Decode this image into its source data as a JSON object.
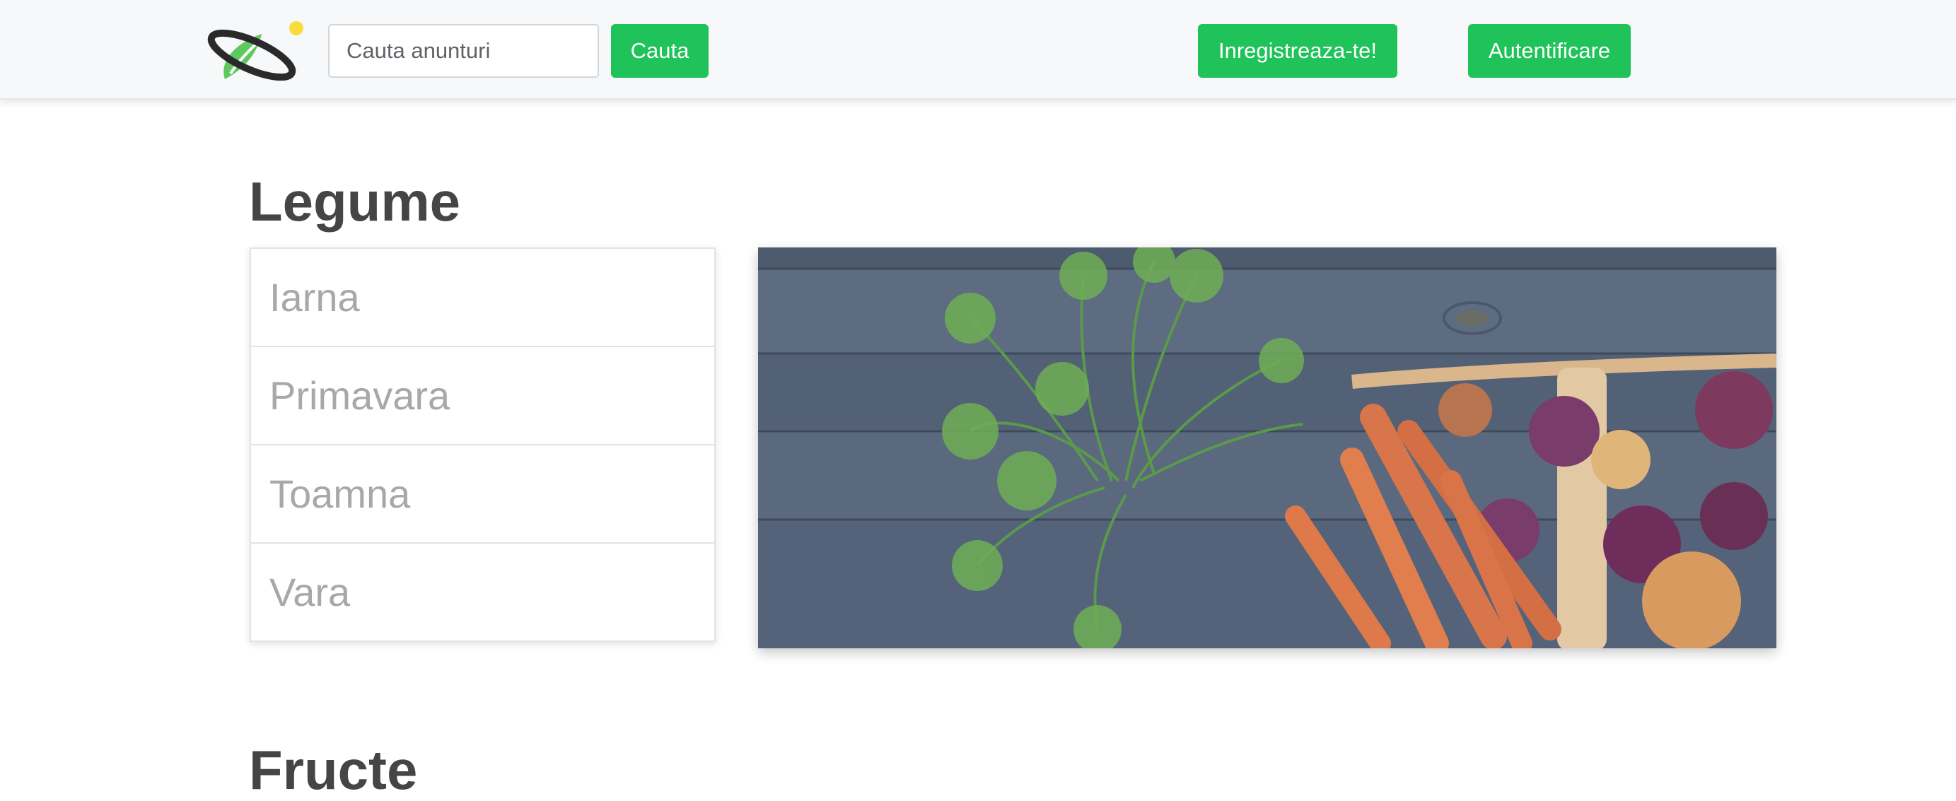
{
  "header": {
    "logo_alt": "logo",
    "search": {
      "placeholder": "Cauta anunturi",
      "value": ""
    },
    "search_button_label": "Cauta",
    "register_button_label": "Inregistreaza-te!",
    "login_button_label": "Autentificare"
  },
  "sections": [
    {
      "title": "Legume",
      "seasons": [
        "Iarna",
        "Primavara",
        "Toamna",
        "Vara"
      ],
      "image_subject": "carrots and onions in a basket on wooden planks"
    },
    {
      "title": "Fructe"
    }
  ],
  "colors": {
    "accent": "#1fc35a",
    "navbar_bg": "#f7f8fa",
    "title_text": "#454545",
    "list_text": "#a8a8a8",
    "logo_dot": "#f7dc3a",
    "logo_leaf": "#5fc85f",
    "logo_ring": "#2a2a2a"
  },
  "icons": {
    "logo": "planet-leaf-logo"
  }
}
